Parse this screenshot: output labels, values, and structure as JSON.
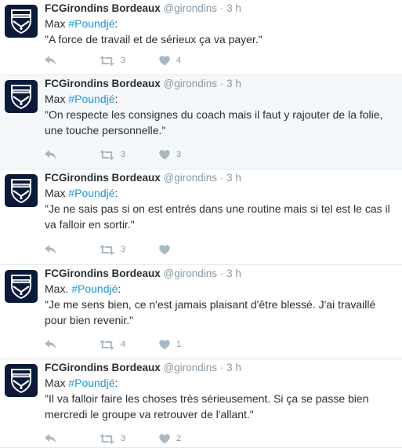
{
  "tweets": [
    {
      "fullname": "FCGirondins Bordeaux",
      "handle": "@girondins",
      "sep": "·",
      "time": "3 h",
      "speaker": "Max ",
      "hashtag": "#Poundjé",
      "colon": ":",
      "quote": "\"A force de travail et de sérieux ça va payer.\"",
      "retweets": "3",
      "likes": "4",
      "highlighted": false
    },
    {
      "fullname": "FCGirondins Bordeaux",
      "handle": "@girondins",
      "sep": "·",
      "time": "3 h",
      "speaker": "Max ",
      "hashtag": "#Poundjé",
      "colon": ":",
      "quote": "\"On respecte les consignes du coach mais il faut y rajouter de la folie, une touche personnelle.\"",
      "retweets": "3",
      "likes": "3",
      "highlighted": true
    },
    {
      "fullname": "FCGirondins Bordeaux",
      "handle": "@girondins",
      "sep": "·",
      "time": "3 h",
      "speaker": "Max ",
      "hashtag": "#Poundjé",
      "colon": ":",
      "quote": "\"Je ne sais pas si on est entrés dans une routine mais si tel est le cas il va falloir en sortir.\"",
      "retweets": "3",
      "likes": "",
      "highlighted": false
    },
    {
      "fullname": "FCGirondins Bordeaux",
      "handle": "@girondins",
      "sep": "·",
      "time": "3 h",
      "speaker": "Max. ",
      "hashtag": "#Poundjé",
      "colon": ":",
      "quote": "\"Je me sens bien, ce n'est jamais plaisant d'être blessé. J'ai travaillé pour bien revenir.\"",
      "retweets": "4",
      "likes": "1",
      "highlighted": false
    },
    {
      "fullname": "FCGirondins Bordeaux",
      "handle": "@girondins",
      "sep": "·",
      "time": "3 h",
      "speaker": "Max ",
      "hashtag": "#Poundjé",
      "colon": ":",
      "quote": "\"Il va falloir faire les choses très sérieusement. Si ça se passe bien mercredi le groupe va retrouver de l'allant.\"",
      "retweets": "3",
      "likes": "2",
      "highlighted": false
    }
  ],
  "icons": {
    "avatar": "girondins-crest-icon",
    "reply": "reply-icon",
    "retweet": "retweet-icon",
    "like": "heart-icon"
  },
  "colors": {
    "hashtag": "#1b95e0",
    "meta": "#8899a6",
    "icon": "#aab8c2",
    "highlight_bg": "#f5f8fa",
    "avatar_bg": "#0b1a3a"
  }
}
